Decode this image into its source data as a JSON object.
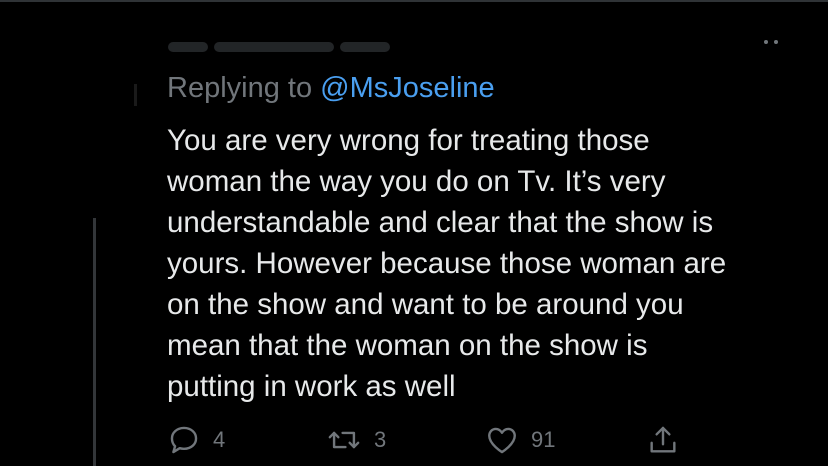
{
  "tweet": {
    "replying_prefix": "Replying to ",
    "replying_handle": "@MsJoseline",
    "text_lines": [
      "You are very wrong for treating those",
      "woman the way you do on Tv. It’s very",
      "understandable and clear that the show is",
      "yours. However because those woman are",
      "on the show and want to be around you",
      "mean that the woman on the show is",
      "putting in work as well"
    ]
  },
  "actions": {
    "reply_icon": "reply-icon",
    "reply_count": "4",
    "retweet_icon": "retweet-icon",
    "retweet_count": "3",
    "like_icon": "heart-icon",
    "like_count": "91",
    "share_icon": "share-icon"
  },
  "colors": {
    "background": "#000000",
    "text": "#e7e9ea",
    "muted": "#71767b",
    "link": "#4a9ff0"
  }
}
